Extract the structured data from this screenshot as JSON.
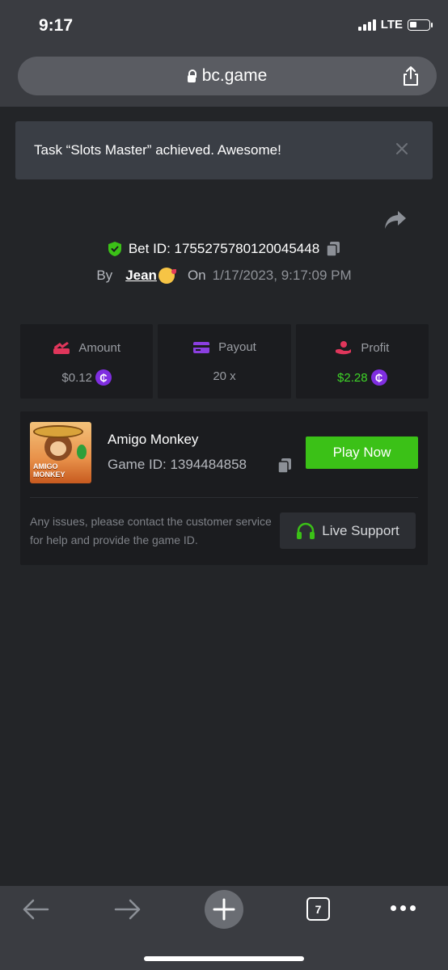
{
  "status": {
    "time": "9:17",
    "network": "LTE"
  },
  "browser": {
    "url": "bc.game",
    "tab_count": "7"
  },
  "toast": {
    "message": "Task “Slots Master” achieved. Awesome!"
  },
  "bet": {
    "id_text": "Bet ID: 1755275780120045448",
    "by_label": "By",
    "user": "Jean",
    "on_label": "On",
    "date": "1/17/2023, 9:17:09 PM"
  },
  "stats": {
    "amount": {
      "label": "Amount",
      "value": "$0.12"
    },
    "payout": {
      "label": "Payout",
      "value": "20 x"
    },
    "profit": {
      "label": "Profit",
      "value": "$2.28"
    }
  },
  "game": {
    "name": "Amigo Monkey",
    "id_text": "Game ID: 1394484858",
    "thumb_line1": "AMIGO",
    "thumb_line2": "MONKEY",
    "play_label": "Play Now",
    "issues_text": "Any issues, please contact the customer service for help and provide the game ID.",
    "support_label": "Live Support"
  },
  "colors": {
    "accent_green": "#3bc117",
    "coin_purple": "#7f2ee0",
    "profit_green": "#3fd528"
  },
  "icons": [
    "lock-icon",
    "share-icon",
    "close-icon",
    "shield-check-icon",
    "copy-icon",
    "amount-icon",
    "card-icon",
    "profit-icon",
    "coin-icon",
    "headset-icon",
    "back-arrow-icon",
    "forward-arrow-icon",
    "plus-icon",
    "tabs-icon",
    "more-icon"
  ]
}
